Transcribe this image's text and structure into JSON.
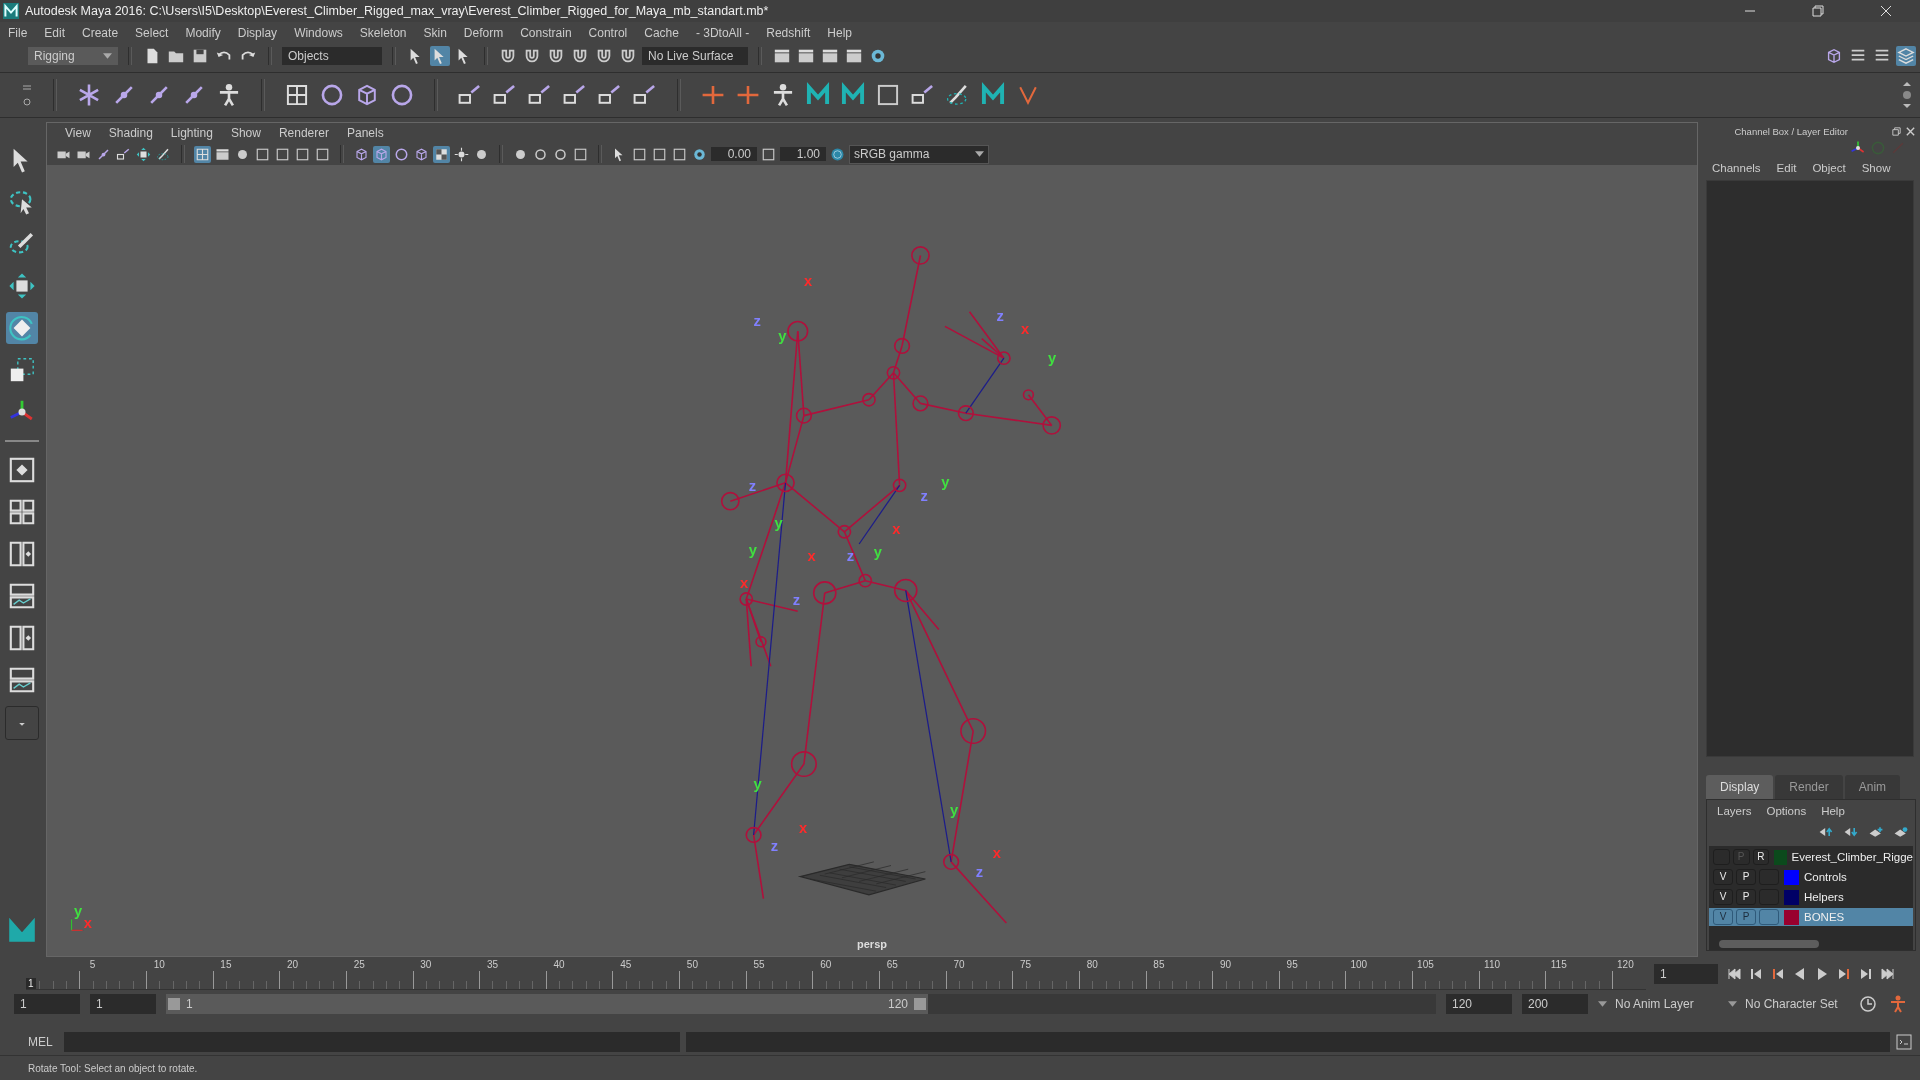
{
  "window": {
    "title": "Autodesk Maya 2016: C:\\Users\\I5\\Desktop\\Everest_Climber_Rigged_max_vray\\Everest_Climber_Rigged_for_Maya_mb_standart.mb*"
  },
  "menu": [
    "File",
    "Edit",
    "Create",
    "Select",
    "Modify",
    "Display",
    "Windows",
    "Skeleton",
    "Skin",
    "Deform",
    "Constrain",
    "Control",
    "Cache",
    "- 3DtoAll -",
    "Redshift",
    "Help"
  ],
  "status_line": {
    "menu_set": "Rigging",
    "selection_mode": "Objects",
    "live_surface": "No Live Surface"
  },
  "toolbox": [
    {
      "kind": "select",
      "selected": false
    },
    {
      "kind": "lasso",
      "selected": false
    },
    {
      "kind": "paint",
      "selected": false
    },
    {
      "kind": "move",
      "selected": false
    },
    {
      "kind": "rotate",
      "selected": true
    },
    {
      "kind": "scale",
      "selected": false
    },
    {
      "kind": "universal",
      "selected": false
    }
  ],
  "panel_menu": [
    "View",
    "Shading",
    "Lighting",
    "Show",
    "Renderer",
    "Panels"
  ],
  "panel_toolbar": {
    "exposure": "0.00",
    "gamma": "1.00",
    "color_space": "sRGB gamma"
  },
  "viewport": {
    "camera": "persp",
    "axis_labels": [
      {
        "text": "x",
        "color": "#ff2a2a"
      },
      {
        "text": "z",
        "color": "#8080ff"
      },
      {
        "text": "y",
        "color": "#40e040"
      },
      {
        "text": "z",
        "color": "#8080ff"
      },
      {
        "text": "x",
        "color": "#ff2a2a"
      },
      {
        "text": "y",
        "color": "#40e040"
      },
      {
        "text": "y",
        "color": "#40e040"
      },
      {
        "text": "z",
        "color": "#8080ff"
      },
      {
        "text": "z",
        "color": "#8080ff"
      },
      {
        "text": "y",
        "color": "#40e040"
      },
      {
        "text": "y",
        "color": "#40e040"
      },
      {
        "text": "x",
        "color": "#ff2a2a"
      },
      {
        "text": "z",
        "color": "#8080ff"
      },
      {
        "text": "y",
        "color": "#40e040"
      },
      {
        "text": "x",
        "color": "#ff2a2a"
      },
      {
        "text": "x",
        "color": "#ff2a2a"
      },
      {
        "text": "z",
        "color": "#8080ff"
      },
      {
        "text": "y",
        "color": "#40e040"
      },
      {
        "text": "x",
        "color": "#ff2a2a"
      },
      {
        "text": "z",
        "color": "#8080ff"
      },
      {
        "text": "y",
        "color": "#40e040"
      },
      {
        "text": "x",
        "color": "#ff2a2a"
      },
      {
        "text": "z",
        "color": "#8080ff"
      },
      {
        "text": "y",
        "color": "#40e040"
      },
      {
        "text": "x",
        "color": "#ff2a2a"
      }
    ]
  },
  "channel_box": {
    "title": "Channel Box / Layer Editor",
    "menu": [
      "Channels",
      "Edit",
      "Object",
      "Show"
    ]
  },
  "layer_editor": {
    "tabs": [
      {
        "label": "Display",
        "selected": true
      },
      {
        "label": "Render",
        "selected": false
      },
      {
        "label": "Anim",
        "selected": false
      }
    ],
    "menu": [
      "Layers",
      "Options",
      "Help"
    ],
    "layers": [
      {
        "name": "Everest_Climber_Rigge",
        "playback": "P",
        "playback_disabled": true,
        "display_type": "R",
        "color": "#0b4a1c",
        "selected": false
      },
      {
        "name": "Controls",
        "visibility": "V",
        "playback": "P",
        "playback_disabled": false,
        "color": "#0000ff",
        "selected": false
      },
      {
        "name": "Helpers",
        "visibility": "V",
        "playback": "P",
        "playback_disabled": false,
        "color": "#000066",
        "selected": false
      },
      {
        "name": "BONES",
        "visibility": "V",
        "playback": "P",
        "playback_disabled": false,
        "color": "#99002e",
        "selected": true
      }
    ]
  },
  "timeline": {
    "marker": "1",
    "level": 0,
    "ticks": [
      "5",
      "10",
      "15",
      "20",
      "25",
      "30",
      "35",
      "40",
      "45",
      "50",
      "55",
      "60",
      "65",
      "70",
      "75",
      "80",
      "85",
      "90",
      "95",
      "100",
      "105",
      "110",
      "115",
      "120"
    ],
    "current_frame": "1"
  },
  "range": {
    "level": 0.6,
    "start": "1",
    "playback_start": "1",
    "slider_start": "1",
    "slider_end": "120",
    "playback_end": "120",
    "end": "200",
    "anim_layer": "No Anim Layer",
    "character_set": "No Character Set"
  },
  "command_line": {
    "label": "MEL"
  },
  "help_line": "Rotate Tool: Select an object to rotate."
}
